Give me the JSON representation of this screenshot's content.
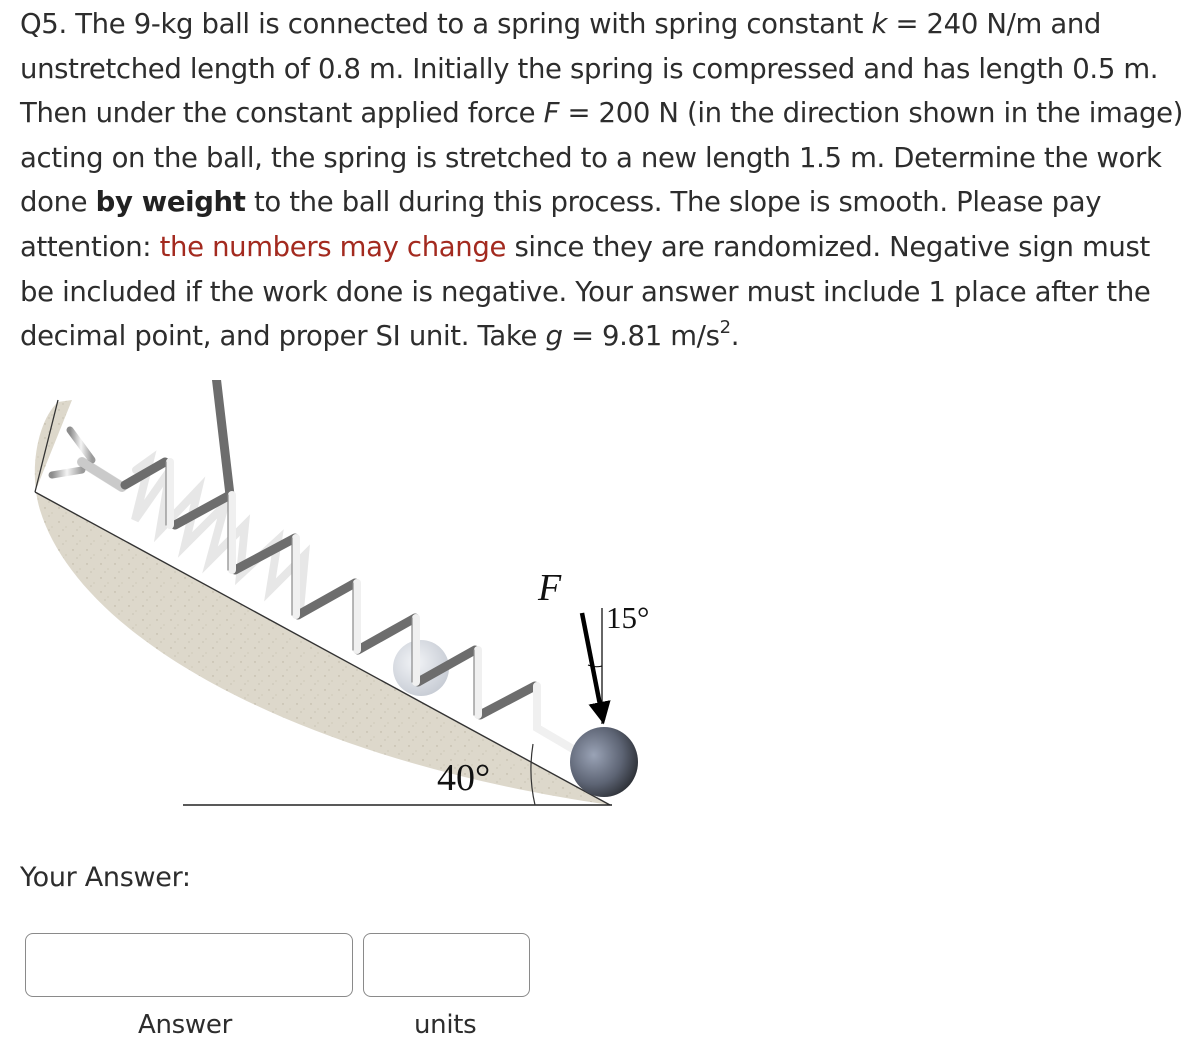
{
  "question": {
    "number": "Q5.",
    "segments": {
      "s1": " The 9-kg ball is connected to a spring with spring constant ",
      "k_symbol": "k",
      "s2": " = 240 N/m and unstretched length of 0.8 m. Initially the spring is compressed and has length 0.5 m. Then under the constant applied force ",
      "F_symbol": "F",
      "s3": " = 200 N (in the direction shown in the image) acting on the ball, the spring is stretched to a new length 1.5 m. Determine the work done ",
      "bold_phrase": "by weight",
      "s4": " to the ball during this process. The slope is smooth.  Please pay attention: ",
      "red_phrase": "the numbers may change",
      "s5": " since they are randomized. Negative sign must be included if the work done is negative. Your answer must include 1 place after the decimal point, and proper SI unit. Take ",
      "g_symbol": "g",
      "s6": " = 9.81 m/s",
      "sup": "2",
      "s7": "."
    },
    "highlight_color": "#a32a1f"
  },
  "figure": {
    "force_label": "F",
    "force_angle_label": "15°",
    "slope_angle_label": "40°",
    "colors": {
      "ground": "#ddd8cb",
      "ball": "#5c6270",
      "spring_dark": "#6e6e6e",
      "spring_light": "#e8e8e8"
    }
  },
  "answer_section": {
    "prompt": "Your Answer:",
    "answer_value": "",
    "answer_label": "Answer",
    "units_value": "",
    "units_label": "units"
  }
}
